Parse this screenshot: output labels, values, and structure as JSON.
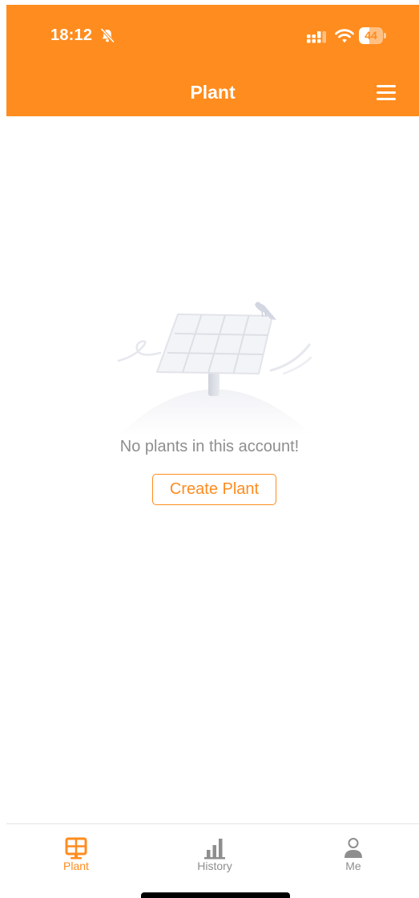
{
  "status_bar": {
    "time": "18:12",
    "battery_level": "44",
    "battery_fraction": 0.44,
    "icons": [
      "bell-slash-icon",
      "signal-icon",
      "wifi-icon",
      "battery-icon"
    ]
  },
  "header": {
    "title": "Plant",
    "menu_icon": "hamburger-menu-icon"
  },
  "empty_state": {
    "illustration": "solar-panel-with-bird-illustration",
    "message": "No plants in this account!",
    "create_button_label": "Create Plant"
  },
  "tab_bar": {
    "tabs": [
      {
        "label": "Plant",
        "icon": "solar-panel-icon",
        "active": true
      },
      {
        "label": "History",
        "icon": "bar-chart-icon",
        "active": false
      },
      {
        "label": "Me",
        "icon": "person-icon",
        "active": false
      }
    ]
  },
  "colors": {
    "accent": "#FF8C1E",
    "inactive_tab": "#8e8e8e",
    "empty_text": "#8e8e8e",
    "background": "#FFFFFF"
  }
}
